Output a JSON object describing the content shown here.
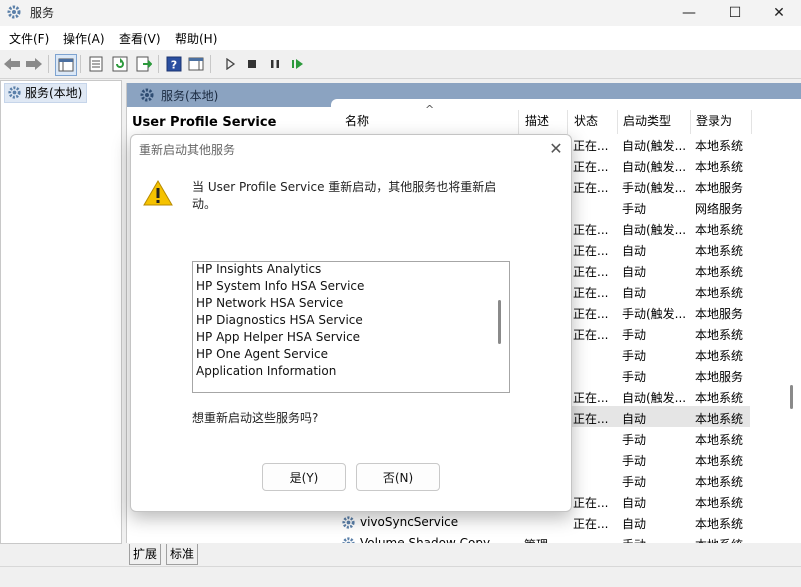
{
  "window": {
    "title": "服务",
    "minimize": "—",
    "maximize": "☐",
    "close": "✕"
  },
  "menu": [
    {
      "label": "文件(F)"
    },
    {
      "label": "操作(A)"
    },
    {
      "label": "查看(V)"
    },
    {
      "label": "帮助(H)"
    }
  ],
  "tree": {
    "item": "服务(本地)"
  },
  "pane": {
    "header": "服务(本地)",
    "selected_service": "User Profile Service",
    "sort_indicator": "^",
    "columns": [
      "名称",
      "描述",
      "状态",
      "启动类型",
      "登录为"
    ]
  },
  "rows": [
    {
      "status": "正在...",
      "startup": "自动(触发...",
      "logon": "本地系统"
    },
    {
      "status": "正在...",
      "startup": "自动(触发...",
      "logon": "本地系统"
    },
    {
      "status": "正在...",
      "startup": "手动(触发...",
      "logon": "本地服务"
    },
    {
      "status": "",
      "startup": "手动",
      "logon": "网络服务"
    },
    {
      "status": "正在...",
      "startup": "自动(触发...",
      "logon": "本地系统"
    },
    {
      "status": "正在...",
      "startup": "自动",
      "logon": "本地系统"
    },
    {
      "status": "正在...",
      "startup": "自动",
      "logon": "本地系统"
    },
    {
      "status": "正在...",
      "startup": "自动",
      "logon": "本地系统"
    },
    {
      "status": "正在...",
      "startup": "手动(触发...",
      "logon": "本地服务"
    },
    {
      "status": "正在...",
      "startup": "手动",
      "logon": "本地系统"
    },
    {
      "status": "",
      "startup": "手动",
      "logon": "本地系统"
    },
    {
      "status": "",
      "startup": "手动",
      "logon": "本地服务"
    },
    {
      "status": "正在...",
      "startup": "自动(触发...",
      "logon": "本地系统"
    },
    {
      "status": "正在...",
      "startup": "自动",
      "logon": "本地系统"
    },
    {
      "status": "",
      "startup": "手动",
      "logon": "本地系统"
    },
    {
      "status": "",
      "startup": "手动",
      "logon": "本地系统"
    },
    {
      "status": "",
      "startup": "手动",
      "logon": "本地系统"
    },
    {
      "status": "正在...",
      "startup": "自动",
      "logon": "本地系统"
    },
    {
      "name": "vivoSyncService",
      "status": "正在...",
      "startup": "自动",
      "logon": "本地系统"
    },
    {
      "name": "Volume Shadow Copy",
      "desc": "管理...",
      "status": "",
      "startup": "手动",
      "logon": "本地系统"
    }
  ],
  "tabs": [
    "扩展",
    "标准"
  ],
  "dialog": {
    "title": "重新启动其他服务",
    "message": "当 User Profile Service 重新启动，其他服务也将重新启动。",
    "services": [
      "HP Insights Analytics",
      "HP System Info HSA Service",
      "HP Network HSA Service",
      "HP Diagnostics HSA Service",
      "HP App Helper HSA Service",
      "HP One Agent Service",
      "Application Information"
    ],
    "question": "想重新启动这些服务吗?",
    "yes": "是(Y)",
    "no": "否(N)",
    "close": "✕"
  },
  "icons": {
    "app": "gear-icon",
    "back": "back-arrow-icon",
    "forward": "forward-arrow-icon",
    "warning": "warning-icon",
    "play": "play-icon",
    "stop": "stop-icon",
    "pause": "pause-icon",
    "resume": "resume-icon"
  },
  "colors": {
    "pane_header": "#8ba3c1",
    "warning": "#f5c200",
    "selection": "#e5e5e5"
  }
}
